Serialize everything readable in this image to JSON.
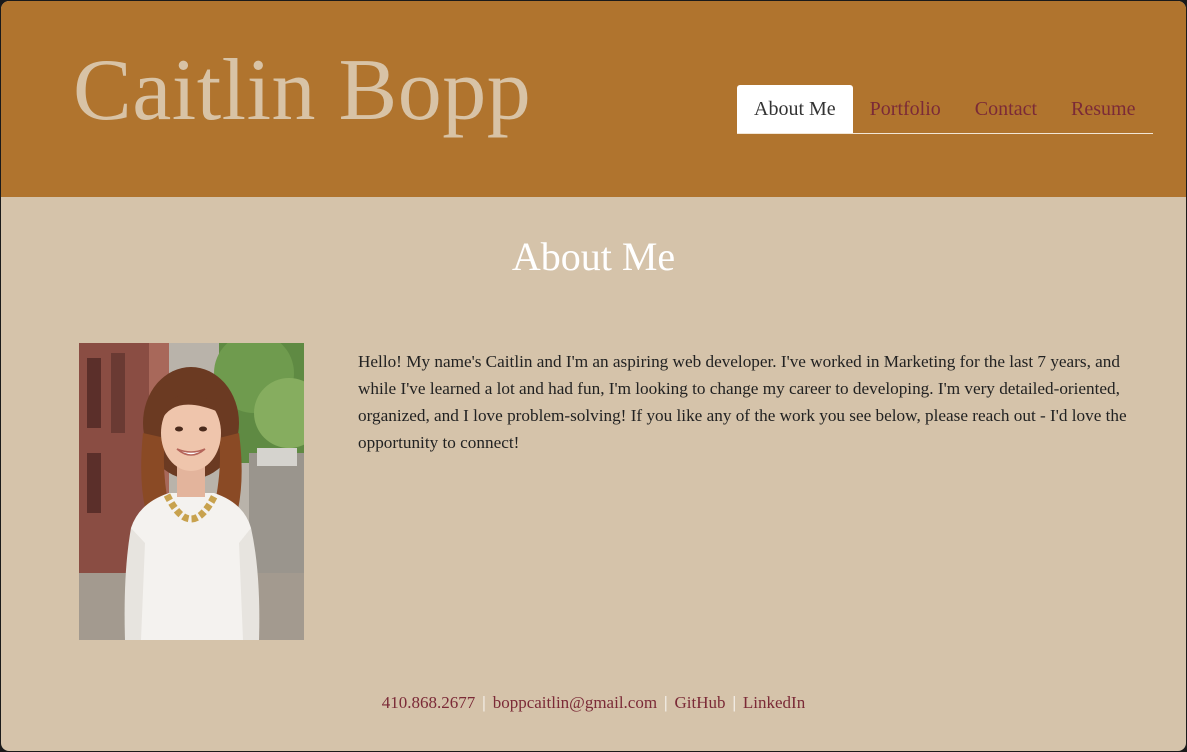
{
  "header": {
    "title": "Caitlin Bopp",
    "nav": [
      {
        "label": "About Me",
        "active": true
      },
      {
        "label": "Portfolio",
        "active": false
      },
      {
        "label": "Contact",
        "active": false
      },
      {
        "label": "Resume",
        "active": false
      }
    ]
  },
  "main": {
    "section_title": "About Me",
    "bio": "Hello! My name's Caitlin and I'm an aspiring web developer. I've worked in Marketing for the last 7 years, and while I've learned a lot and had fun, I'm looking to change my career to developing. I'm very detailed-oriented, organized, and I love problem-solving! If you like any of the work you see below, please reach out - I'd love the opportunity to connect!"
  },
  "footer": {
    "phone": "410.868.2677",
    "email": "boppcaitlin@gmail.com",
    "github": "GitHub",
    "linkedin": "LinkedIn",
    "separator": "|"
  },
  "colors": {
    "header_bg": "#b0742e",
    "page_bg": "#d5c3aa",
    "title": "#d8c3a6",
    "link": "#7b2a37",
    "heading": "#ffffff"
  }
}
